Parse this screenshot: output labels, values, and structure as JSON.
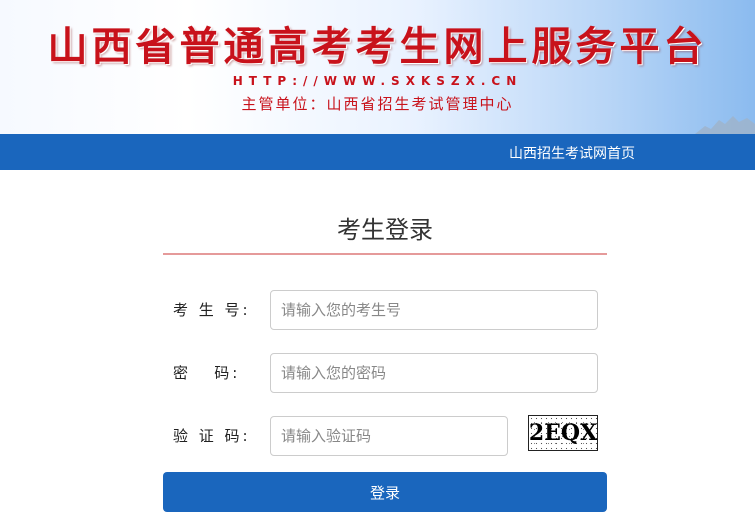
{
  "banner": {
    "title": "山西省普通高考考生网上服务平台",
    "url": "HTTP://WWW.SXKSZX.CN",
    "subtitle": "主管单位：山西省招生考试管理中心"
  },
  "nav": {
    "home_link": "山西招生考试网首页"
  },
  "login": {
    "title": "考生登录",
    "exam_number": {
      "label": "考 生 号:",
      "placeholder": "请输入您的考生号",
      "value": ""
    },
    "password": {
      "label": "密   码:",
      "placeholder": "请输入您的密码",
      "value": ""
    },
    "captcha": {
      "label": "验 证 码:",
      "placeholder": "请输入验证码",
      "value": "",
      "image_text": "2EQX"
    },
    "submit_label": "登录"
  },
  "colors": {
    "brand_blue": "#1a66bd",
    "banner_red": "#c8121b",
    "title_underline": "#e59a9a"
  }
}
